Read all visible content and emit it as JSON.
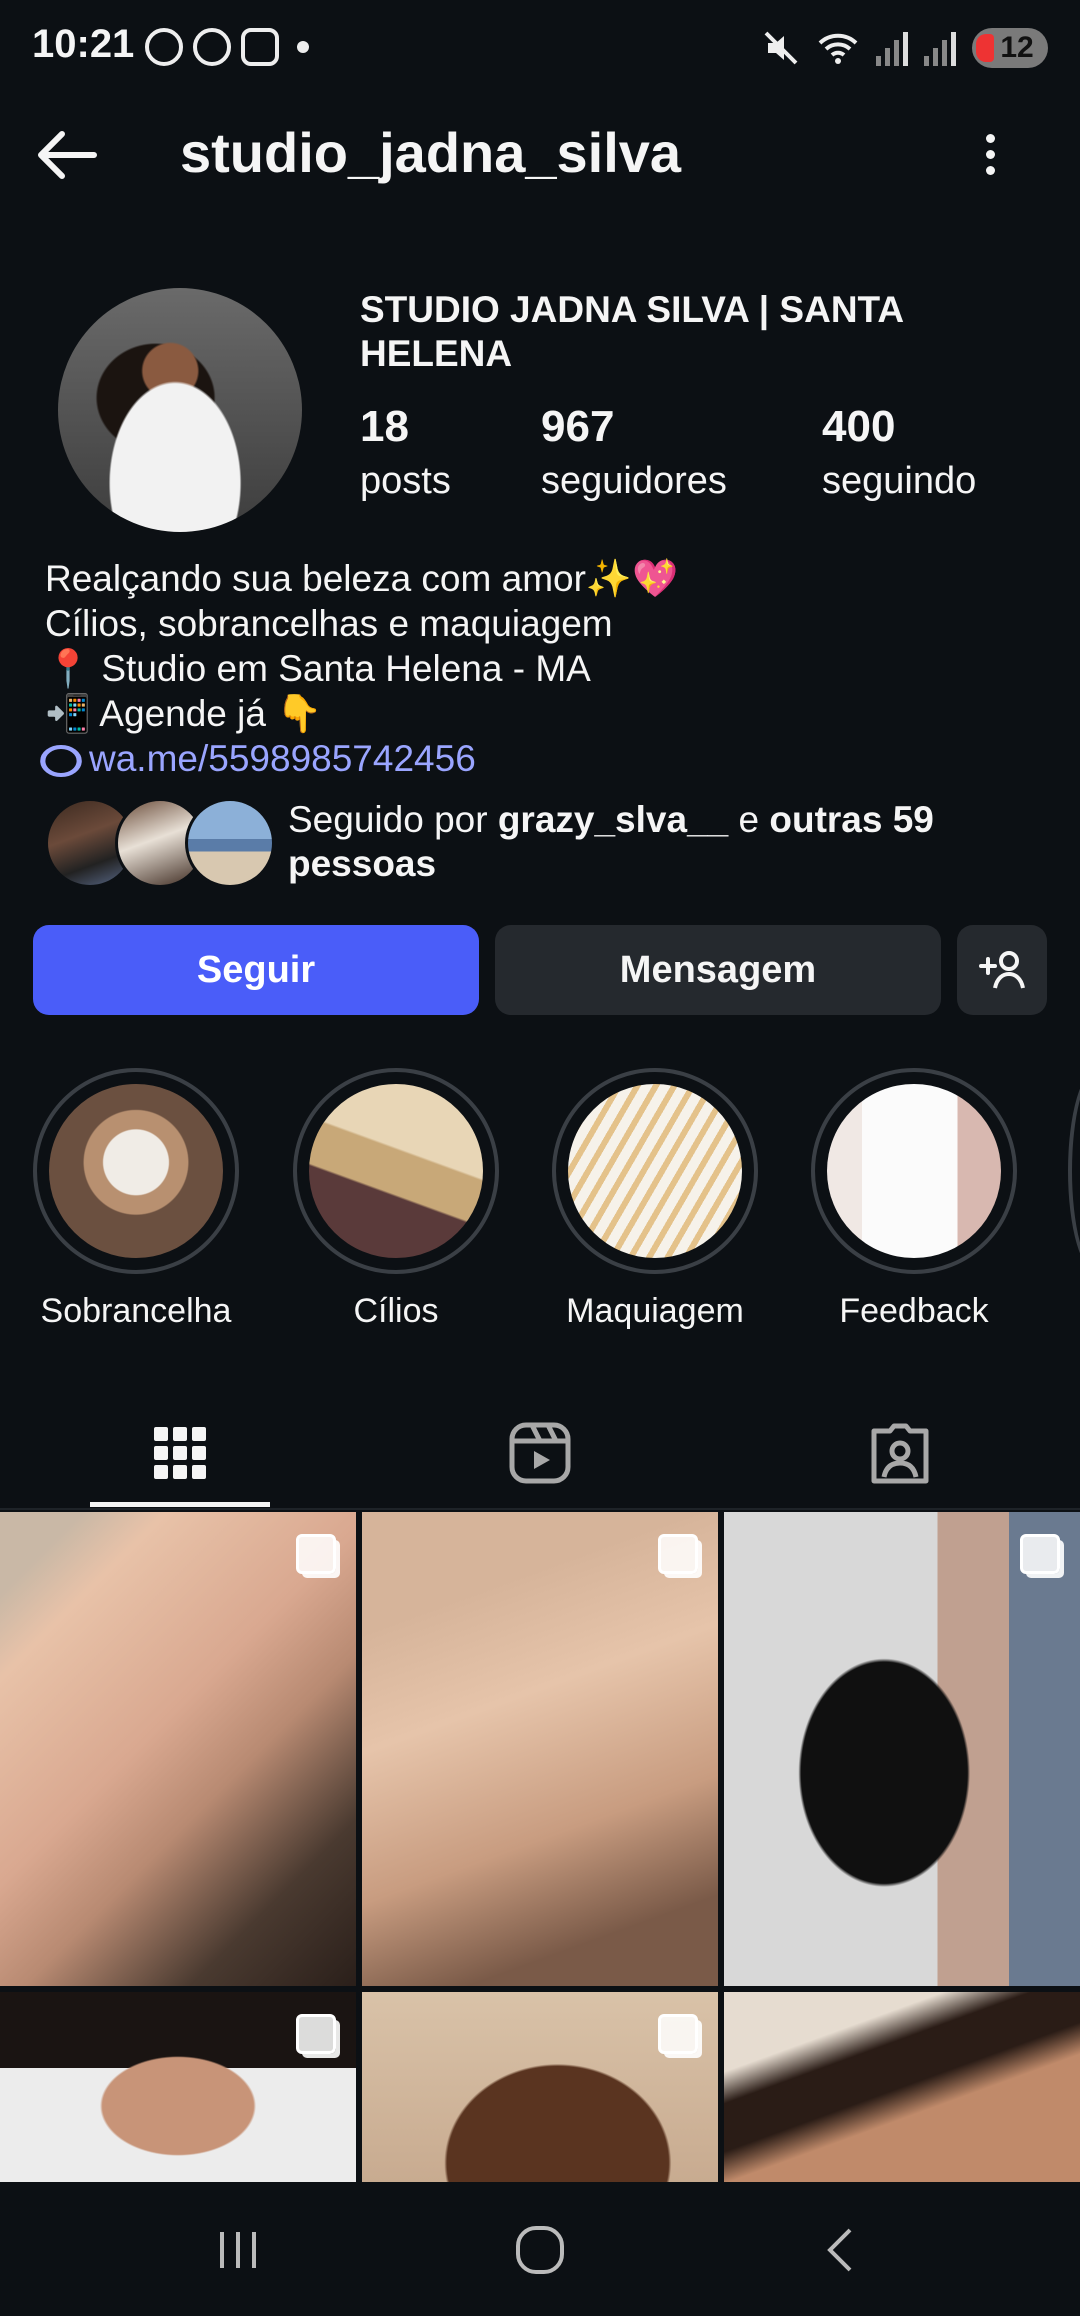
{
  "status_bar": {
    "time": "10:21",
    "battery": "12",
    "icons": [
      "whatsapp-icon",
      "whatsapp-icon",
      "instagram-icon",
      "mute-icon",
      "wifi-icon",
      "signal-icon",
      "signal-icon"
    ]
  },
  "header": {
    "username": "studio_jadna_silva"
  },
  "profile": {
    "name": "STUDIO JADNA SILVA | SANTA HELENA",
    "stats": [
      {
        "value": "18",
        "label": "posts"
      },
      {
        "value": "967",
        "label": "seguidores"
      },
      {
        "value": "400",
        "label": "seguindo"
      }
    ],
    "bio": [
      "Realçando sua beleza com amor✨💖",
      "Cílios, sobrancelhas e maquiagem",
      "📍 Studio em Santa Helena - MA",
      "📲 Agende já 👇"
    ],
    "link": "wa.me/5598985742456",
    "followed_by": {
      "prefix": "Seguido por",
      "user": "grazy_slva__",
      "middle": "e",
      "others": "outras 59 pessoas"
    }
  },
  "actions": {
    "follow": "Seguir",
    "message": "Mensagem"
  },
  "highlights": [
    {
      "label": "Sobrancelha"
    },
    {
      "label": "Cílios"
    },
    {
      "label": "Maquiagem"
    },
    {
      "label": "Feedback"
    }
  ],
  "tabs": [
    "grid-icon",
    "reels-icon",
    "tagged-icon"
  ],
  "colors": {
    "background": "#0c1014",
    "accent": "#4a5df9",
    "link": "#9aa5ff"
  }
}
